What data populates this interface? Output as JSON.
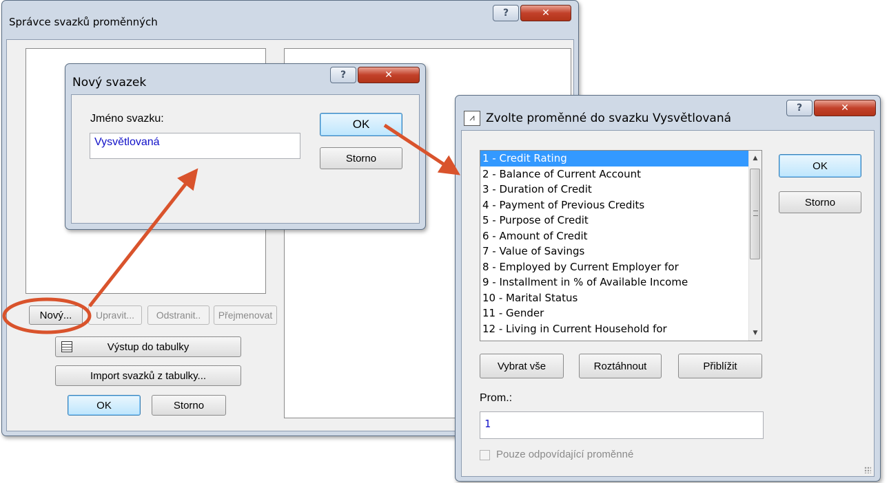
{
  "bundle_manager": {
    "title": "Správce svazků proměnných",
    "buttons": {
      "new": "Nový...",
      "edit": "Upravit...",
      "remove": "Odstranit..",
      "rename": "Přejmenovat",
      "export": "Výstup do tabulky",
      "import": "Import svazků z tabulky...",
      "ok": "OK",
      "cancel": "Storno"
    }
  },
  "new_bundle": {
    "title": "Nový svazek",
    "name_label": "Jméno svazku:",
    "name_value": "Vysvětlovaná",
    "ok": "OK",
    "cancel": "Storno"
  },
  "select_vars": {
    "title": "Zvolte proměnné do svazku Vysvětlovaná",
    "items": [
      "1 - Credit Rating",
      "2 - Balance of Current Account",
      "3 - Duration of Credit",
      "4 - Payment of Previous Credits",
      "5 - Purpose of Credit",
      "6 - Amount of Credit",
      "7 - Value of Savings",
      "8 - Employed by Current Employer for",
      "9 - Installment in % of Available Income",
      "10 - Marital Status",
      "11 - Gender",
      "12 - Living in Current Household for"
    ],
    "selected_index": 0,
    "ok": "OK",
    "cancel": "Storno",
    "select_all": "Vybrat vše",
    "expand": "Roztáhnout",
    "zoom": "Přiblížit",
    "vars_label": "Prom.:",
    "vars_value": "1",
    "matching_only": "Pouze odpovídající proměnné"
  },
  "annotation_color": "#d9532c",
  "selection_color": "#3399ff"
}
